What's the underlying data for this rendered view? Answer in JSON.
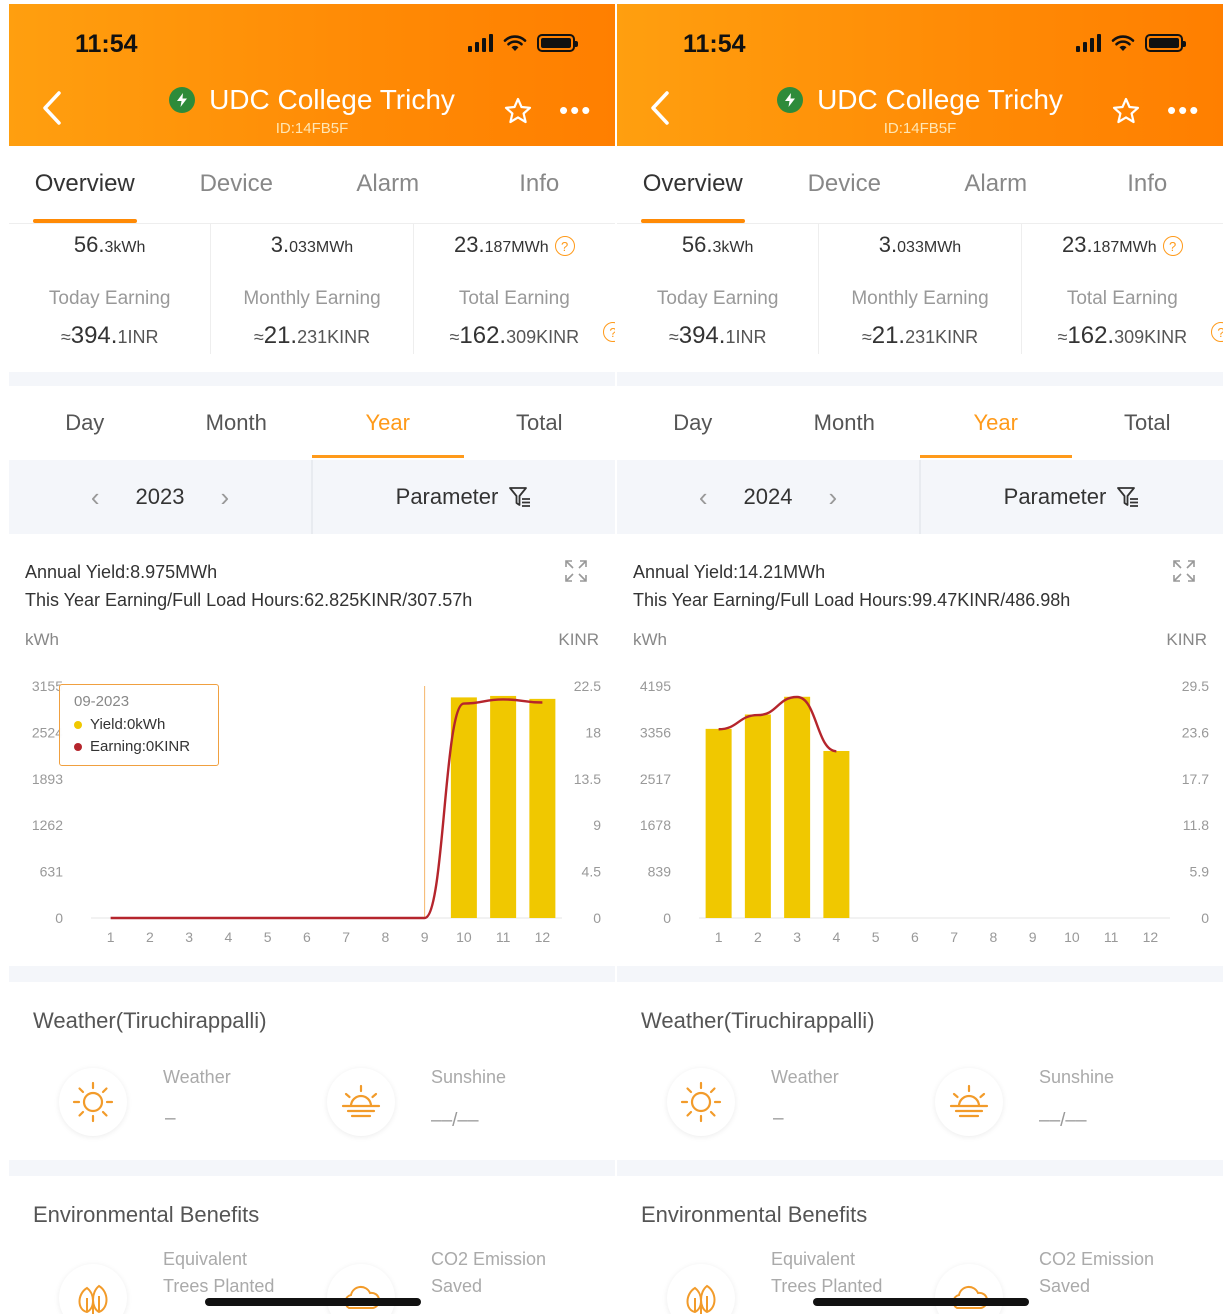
{
  "colors": {
    "header": "#ff8a05",
    "accent": "#ff9a1a",
    "bar": "#f0c800",
    "line": "#b5252c",
    "status_green": "#2e8b3a"
  },
  "panels": [
    {
      "status_time": "11:54",
      "plant_name": "UDC College Trichy",
      "plant_id": "ID:14FB5F",
      "tabs": [
        "Overview",
        "Device",
        "Alarm",
        "Info"
      ],
      "active_tab": 0,
      "summary": [
        {
          "value": "56.",
          "value_tail": "3",
          "unit": "kWh",
          "label": "Today Earning",
          "earn_prefix": "≈",
          "earn_big": "394.",
          "earn_tail": "1INR"
        },
        {
          "value": "3.",
          "value_tail": "033",
          "unit": "MWh",
          "label": "Monthly Earning",
          "earn_prefix": "≈",
          "earn_big": "21.",
          "earn_tail": "231KINR"
        },
        {
          "value": "23.",
          "value_tail": "187",
          "unit": "MWh",
          "label": "Total Earning",
          "earn_prefix": "≈",
          "earn_big": "162.",
          "earn_tail": "309KINR"
        }
      ],
      "period_tabs": [
        "Day",
        "Month",
        "Year",
        "Total"
      ],
      "active_period": 2,
      "year": "2023",
      "parameter_label": "Parameter",
      "annual_yield": "Annual Yield:8.975MWh",
      "year_earning": "This Year Earning/Full Load Hours:62.825KINR/307.57h",
      "left_unit": "kWh",
      "right_unit": "KINR",
      "tooltip": {
        "date": "09-2023",
        "yield": "Yield:0kWh",
        "earning": "Earning:0KINR"
      },
      "chart_data": {
        "type": "bar",
        "categories": [
          "1",
          "2",
          "3",
          "4",
          "5",
          "6",
          "7",
          "8",
          "9",
          "10",
          "11",
          "12"
        ],
        "left_ticks": [
          "3155",
          "2524",
          "1893",
          "1262",
          "631",
          "0"
        ],
        "right_ticks": [
          "22.5",
          "18",
          "13.5",
          "9",
          "4.5",
          "0"
        ],
        "ylim": [
          0,
          3155
        ],
        "ylim_right": [
          0,
          22.5
        ],
        "series": [
          {
            "name": "Yield",
            "values": [
              0,
              0,
              0,
              0,
              0,
              0,
              0,
              0,
              0,
              3000,
              3020,
              2980
            ]
          },
          {
            "name": "Earning",
            "values": [
              0,
              0,
              0,
              0,
              0,
              0,
              0,
              0,
              0,
              20.8,
              21.2,
              20.9
            ]
          }
        ],
        "highlight_index": 8
      },
      "weather_title": "Weather(Tiruchirappalli)",
      "weather_label": "Weather",
      "weather_value": "–",
      "sunshine_label": "Sunshine",
      "sunshine_value": "––/––",
      "env_title": "Environmental Benefits",
      "trees_label_1": "Equivalent",
      "trees_label_2": "Trees Planted",
      "co2_label_1": "CO2 Emission",
      "co2_label_2": "Saved"
    },
    {
      "status_time": "11:54",
      "plant_name": "UDC College Trichy",
      "plant_id": "ID:14FB5F",
      "tabs": [
        "Overview",
        "Device",
        "Alarm",
        "Info"
      ],
      "active_tab": 0,
      "summary": [
        {
          "value": "56.",
          "value_tail": "3",
          "unit": "kWh",
          "label": "Today Earning",
          "earn_prefix": "≈",
          "earn_big": "394.",
          "earn_tail": "1INR"
        },
        {
          "value": "3.",
          "value_tail": "033",
          "unit": "MWh",
          "label": "Monthly Earning",
          "earn_prefix": "≈",
          "earn_big": "21.",
          "earn_tail": "231KINR"
        },
        {
          "value": "23.",
          "value_tail": "187",
          "unit": "MWh",
          "label": "Total Earning",
          "earn_prefix": "≈",
          "earn_big": "162.",
          "earn_tail": "309KINR"
        }
      ],
      "period_tabs": [
        "Day",
        "Month",
        "Year",
        "Total"
      ],
      "active_period": 2,
      "year": "2024",
      "parameter_label": "Parameter",
      "annual_yield": "Annual Yield:14.21MWh",
      "year_earning": "This Year Earning/Full Load Hours:99.47KINR/486.98h",
      "left_unit": "kWh",
      "right_unit": "KINR",
      "chart_data": {
        "type": "bar",
        "categories": [
          "1",
          "2",
          "3",
          "4",
          "5",
          "6",
          "7",
          "8",
          "9",
          "10",
          "11",
          "12"
        ],
        "left_ticks": [
          "4195",
          "3356",
          "2517",
          "1678",
          "839",
          "0"
        ],
        "right_ticks": [
          "29.5",
          "23.6",
          "17.7",
          "11.8",
          "5.9",
          "0"
        ],
        "ylim": [
          0,
          4195
        ],
        "ylim_right": [
          0,
          29.5
        ],
        "series": [
          {
            "name": "Yield",
            "values": [
              3420,
              3680,
              4000,
              3020,
              0,
              0,
              0,
              0,
              0,
              0,
              0,
              0
            ]
          },
          {
            "name": "Earning",
            "values": [
              24.0,
              25.8,
              28.1,
              21.2,
              0,
              0,
              0,
              0,
              0,
              0,
              0,
              0
            ]
          }
        ],
        "highlight_index": -1
      },
      "weather_title": "Weather(Tiruchirappalli)",
      "weather_label": "Weather",
      "weather_value": "–",
      "sunshine_label": "Sunshine",
      "sunshine_value": "––/––",
      "env_title": "Environmental Benefits",
      "trees_label_1": "Equivalent",
      "trees_label_2": "Trees Planted",
      "co2_label_1": "CO2 Emission",
      "co2_label_2": "Saved"
    }
  ]
}
